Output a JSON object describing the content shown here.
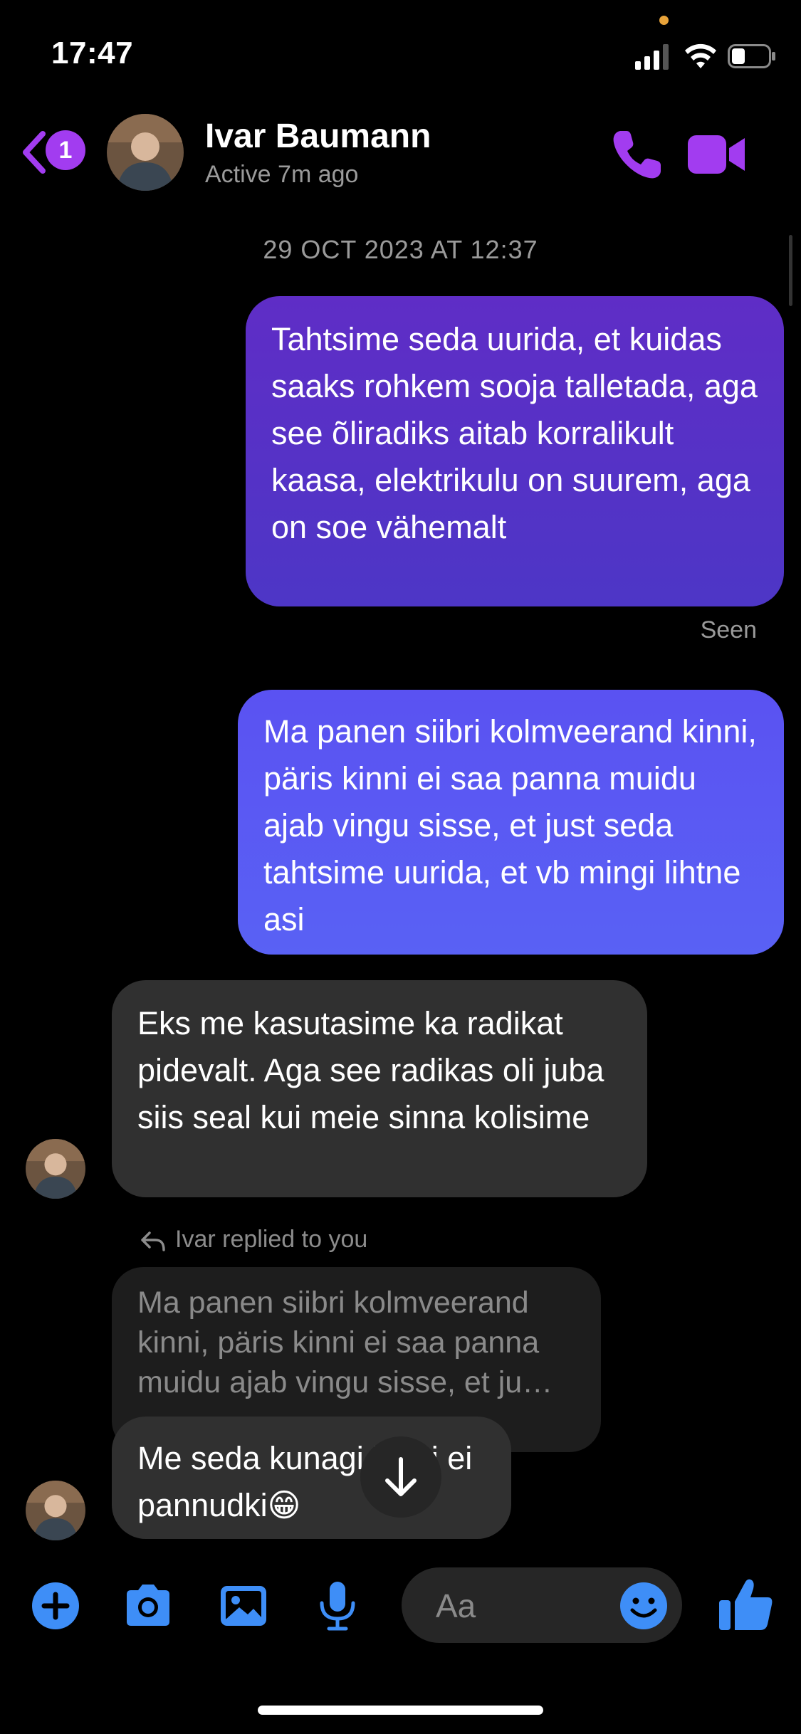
{
  "status_bar": {
    "time": "17:47"
  },
  "header": {
    "back_badge": "1",
    "contact_name": "Ivar Baumann",
    "status": "Active 7m ago",
    "accent": "#a23cf0"
  },
  "thread": {
    "timestamp": "29 OCT 2023 AT 12:37",
    "messages": [
      {
        "from": "me",
        "text": "Tahtsime seda uurida, et kuidas saaks rohkem sooja talletada, aga see õliradiks aitab korralikult kaasa, elektrikulu on suurem, aga on soe vähemalt"
      },
      {
        "from": "me",
        "text": "Ma panen siibri kolmveerand kinni, päris kinni ei saa panna muidu ajab vingu sisse, et just seda tahtsime uurida, et vb mingi lihtne asi"
      },
      {
        "from": "them",
        "text": "Eks me kasutasime ka radikat pidevalt. Aga see radikas oli juba siis seal kui meie sinna kolisime"
      },
      {
        "from": "them",
        "text": "Me seda kunagi kinni ei pannudki😁"
      }
    ],
    "seen_label": "Seen",
    "reply_label": "Ivar replied to you",
    "quoted_text": "Ma panen siibri kolmveerand kinni, päris kinni ei saa panna muidu ajab vingu sisse, et ju…"
  },
  "composer": {
    "placeholder": "Aa",
    "icons": [
      "plus-icon",
      "camera-icon",
      "gallery-icon",
      "microphone-icon",
      "emoji-icon",
      "thumbs-up-icon"
    ],
    "icon_color": "#3e8ef7"
  }
}
